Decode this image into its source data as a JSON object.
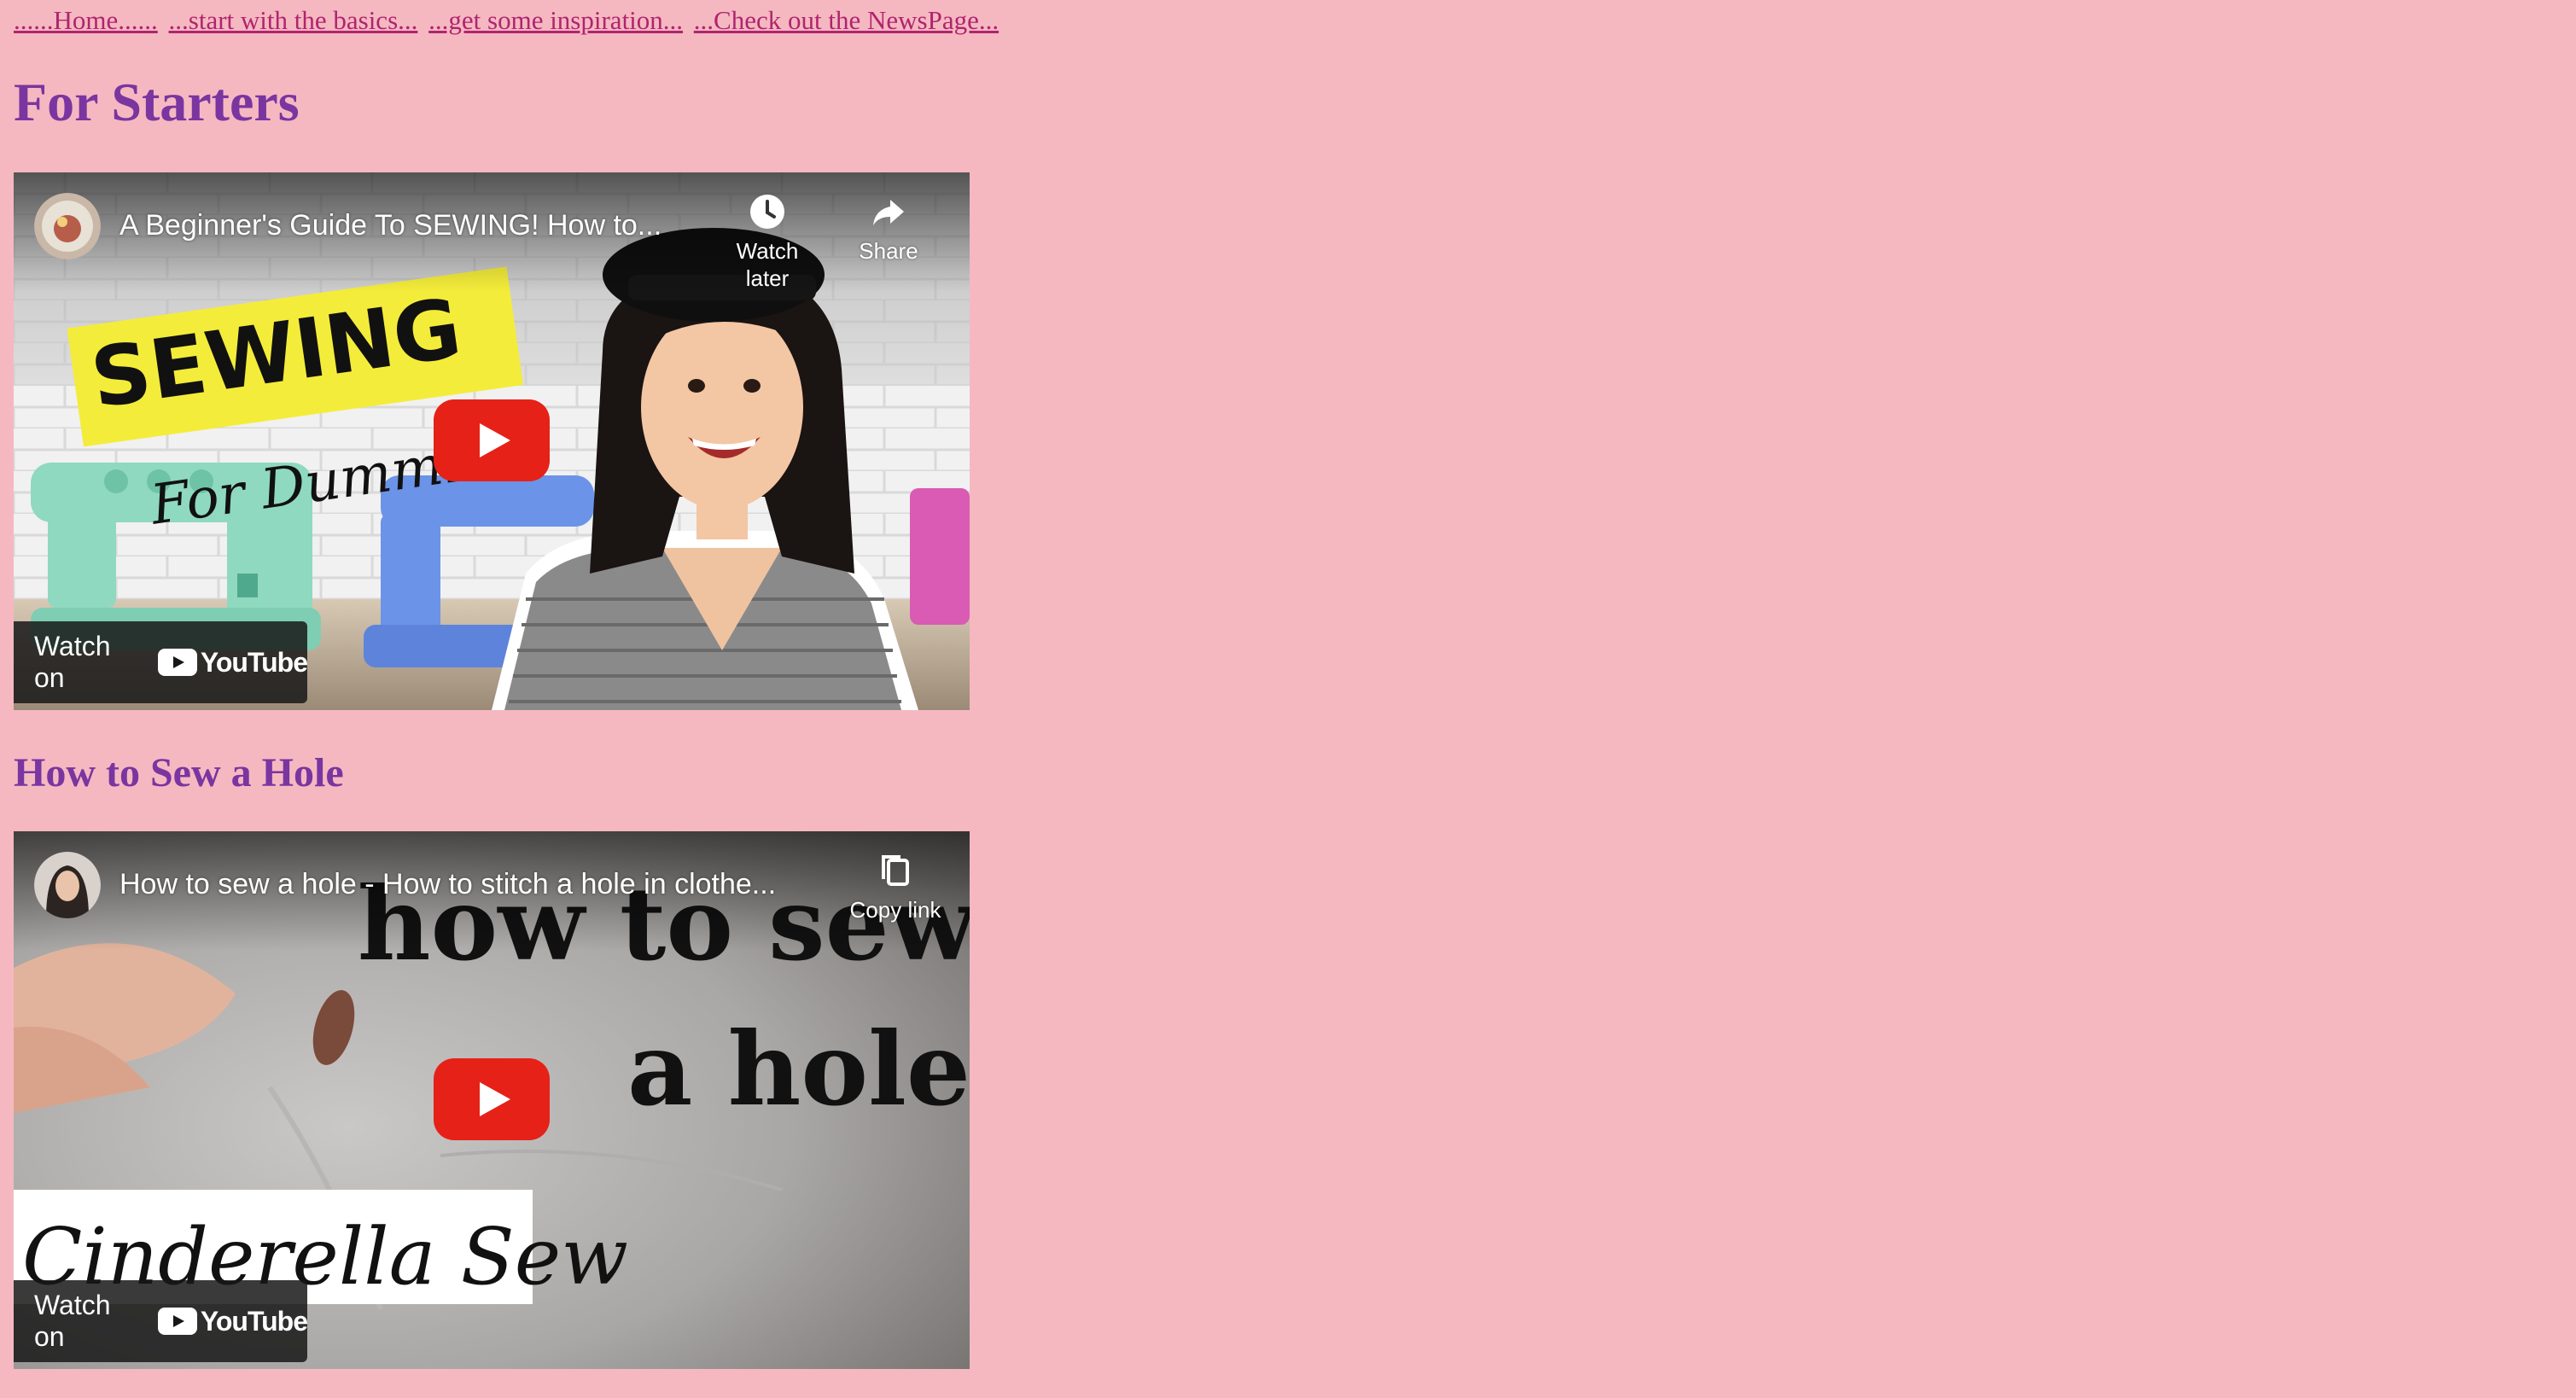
{
  "nav": {
    "links": [
      "......Home......",
      "...start with the basics...",
      "...get some inspiration...",
      "...Check out the NewsPage..."
    ]
  },
  "sections": {
    "starters_heading": "For Starters",
    "hole_heading": "How to Sew a Hole"
  },
  "video1": {
    "title": "A Beginner's Guide To SEWING! How to...",
    "action1_label": "Watch later",
    "action2_label": "Share",
    "thumb_text_1": "SEWING",
    "thumb_text_2": "For Dummies!",
    "watch_on": "Watch on",
    "youtube": "YouTube"
  },
  "video2": {
    "title": "How to sew a hole - How to stitch a hole in clothe...",
    "action1_label": "Copy link",
    "thumb_text_1": "how to sew",
    "thumb_text_2": "a hole",
    "thumb_text_3": "Cinderella Sew",
    "watch_on": "Watch on",
    "youtube": "YouTube"
  },
  "colors": {
    "background": "#f5b8c1",
    "link": "#b0246e",
    "heading": "#7a35a0",
    "youtube_red": "#e62117"
  },
  "icons": [
    "clock-icon",
    "share-icon",
    "copy-link-icon",
    "play-icon",
    "youtube-logo-icon"
  ]
}
